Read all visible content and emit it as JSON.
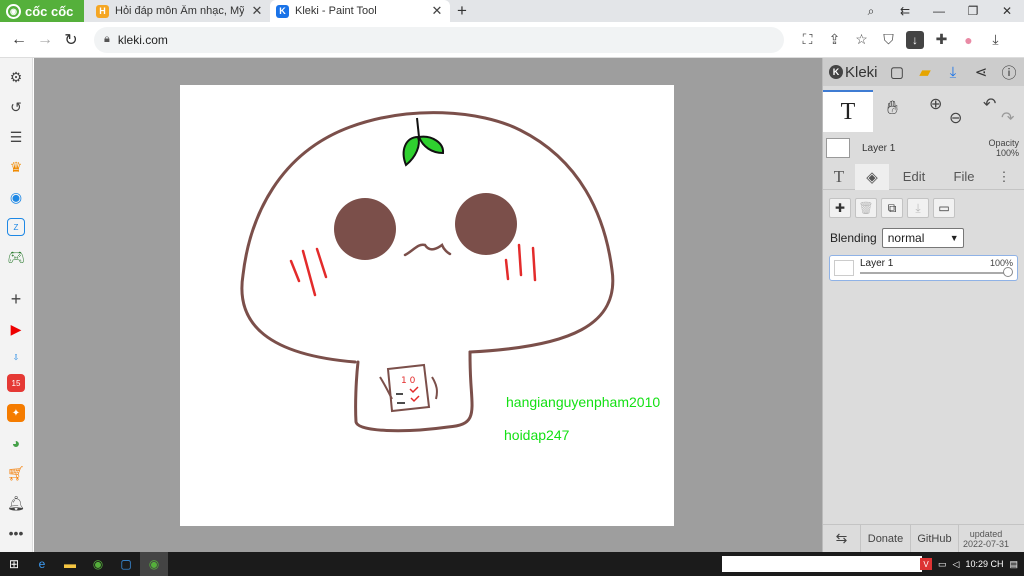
{
  "browser": {
    "brand": "cốc cốc",
    "tabs": [
      {
        "title": "Hỏi đáp môn Âm nhạc, Mỹ thuật",
        "favicon_color": "#f5a623"
      },
      {
        "title": "Kleki - Paint Tool",
        "favicon_color": "#1a73e8"
      }
    ],
    "url": "kleki.com"
  },
  "canvas": {
    "signature_1": "hangianguyenpham2010",
    "signature_2": "hoidap247",
    "colors": {
      "outline": "#7b4f4a",
      "cheeks_fill": "#7b4f4a",
      "blush": "#e32b2b",
      "leaf": "#2fd12f",
      "signature": "#14e014"
    }
  },
  "kleki": {
    "logo_text": "Kleki",
    "active_tool": "T",
    "layer_preview_name": "Layer 1",
    "opacity_label": "Opacity",
    "opacity_value": "100%",
    "tabs": {
      "text": "T",
      "edit": "Edit",
      "file": "File"
    },
    "blending_label": "Blending",
    "blending_value": "normal",
    "layer": {
      "name": "Layer 1",
      "opacity": "100%"
    },
    "footer": {
      "donate": "Donate",
      "github": "GitHub",
      "updated_label": "updated",
      "updated_date": "2022-07-31"
    }
  },
  "taskbar": {
    "time": "10:29 CH"
  }
}
